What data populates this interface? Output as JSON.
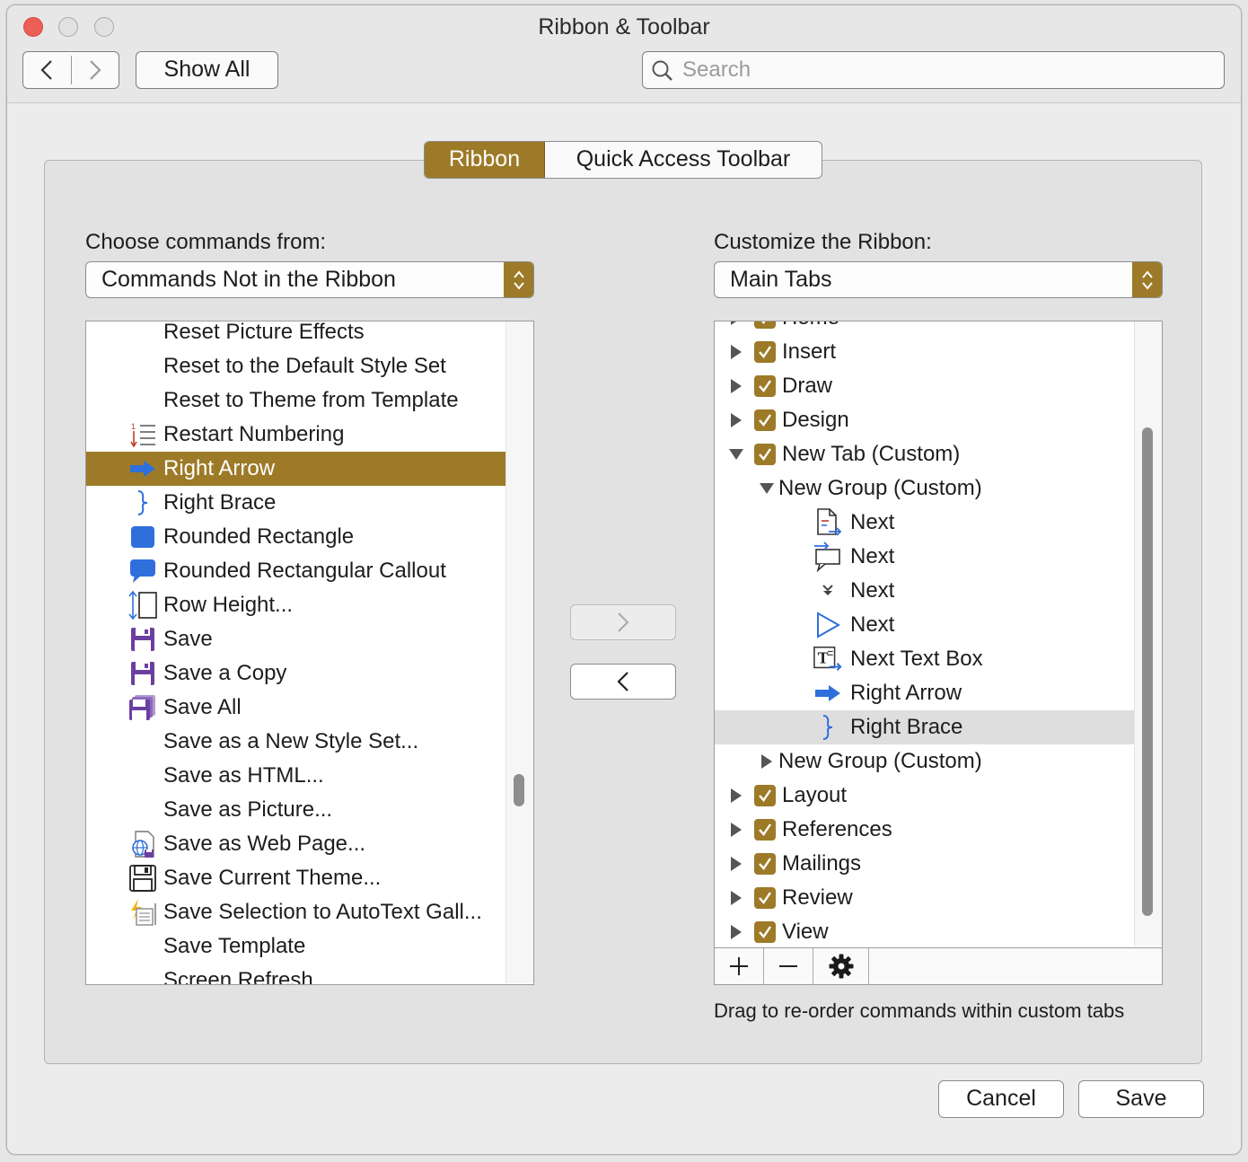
{
  "window": {
    "title": "Ribbon & Toolbar"
  },
  "toolbar": {
    "show_all_label": "Show All",
    "search_placeholder": "Search"
  },
  "tabs": {
    "ribbon": "Ribbon",
    "quick_access": "Quick Access Toolbar"
  },
  "left": {
    "label": "Choose commands from:",
    "dropdown_value": "Commands Not in the Ribbon",
    "items": [
      {
        "label": "Reset Picture Effects",
        "icon": ""
      },
      {
        "label": "Reset to the Default Style Set",
        "icon": ""
      },
      {
        "label": "Reset to Theme from Template",
        "icon": ""
      },
      {
        "label": "Restart Numbering",
        "icon": "restart-numbering-icon"
      },
      {
        "label": "Right Arrow",
        "icon": "right-arrow-icon",
        "selected": true
      },
      {
        "label": "Right Brace",
        "icon": "right-brace-icon"
      },
      {
        "label": "Rounded Rectangle",
        "icon": "rounded-rectangle-icon"
      },
      {
        "label": "Rounded Rectangular Callout",
        "icon": "rounded-callout-icon"
      },
      {
        "label": "Row Height...",
        "icon": "row-height-icon"
      },
      {
        "label": "Save",
        "icon": "save-icon"
      },
      {
        "label": "Save a Copy",
        "icon": "save-copy-icon"
      },
      {
        "label": "Save All",
        "icon": "save-all-icon"
      },
      {
        "label": "Save as a New Style Set...",
        "icon": ""
      },
      {
        "label": "Save as HTML...",
        "icon": ""
      },
      {
        "label": "Save as Picture...",
        "icon": ""
      },
      {
        "label": "Save as Web Page...",
        "icon": "save-web-page-icon"
      },
      {
        "label": "Save Current Theme...",
        "icon": "save-theme-icon"
      },
      {
        "label": "Save Selection to AutoText Gall...",
        "icon": "autotext-icon"
      },
      {
        "label": "Save Template",
        "icon": ""
      },
      {
        "label": "Screen Refresh",
        "icon": ""
      }
    ]
  },
  "right": {
    "label": "Customize the Ribbon:",
    "dropdown_value": "Main Tabs",
    "items": [
      {
        "label": "Home",
        "level": 0,
        "disclosure": "right",
        "checked": true,
        "partial": true
      },
      {
        "label": "Insert",
        "level": 0,
        "disclosure": "right",
        "checked": true
      },
      {
        "label": "Draw",
        "level": 0,
        "disclosure": "right",
        "checked": true
      },
      {
        "label": "Design",
        "level": 0,
        "disclosure": "right",
        "checked": true
      },
      {
        "label": "New Tab (Custom)",
        "level": 0,
        "disclosure": "down",
        "checked": true
      },
      {
        "label": "New Group (Custom)",
        "level": 1,
        "disclosure": "down"
      },
      {
        "label": "Next",
        "level": 2,
        "icon": "next-comment-icon"
      },
      {
        "label": "Next",
        "level": 2,
        "icon": "next-callout-icon"
      },
      {
        "label": "Next",
        "level": 2,
        "icon": "next-down-icon"
      },
      {
        "label": "Next",
        "level": 2,
        "icon": "next-play-icon"
      },
      {
        "label": "Next Text Box",
        "level": 2,
        "icon": "next-text-box-icon"
      },
      {
        "label": "Right Arrow",
        "level": 2,
        "icon": "right-arrow-icon"
      },
      {
        "label": "Right Brace",
        "level": 2,
        "icon": "right-brace-icon",
        "highlighted": true
      },
      {
        "label": "New Group (Custom)",
        "level": 1,
        "disclosure": "right"
      },
      {
        "label": "Layout",
        "level": 0,
        "disclosure": "right",
        "checked": true
      },
      {
        "label": "References",
        "level": 0,
        "disclosure": "right",
        "checked": true
      },
      {
        "label": "Mailings",
        "level": 0,
        "disclosure": "right",
        "checked": true
      },
      {
        "label": "Review",
        "level": 0,
        "disclosure": "right",
        "checked": true
      },
      {
        "label": "View",
        "level": 0,
        "disclosure": "right",
        "checked": true
      }
    ],
    "hint": "Drag to re-order commands within custom tabs"
  },
  "footer": {
    "cancel": "Cancel",
    "save": "Save"
  },
  "colors": {
    "accent": "#9d7a28",
    "icon_blue": "#2f6fdc",
    "save_purple": "#6b3fa0"
  }
}
